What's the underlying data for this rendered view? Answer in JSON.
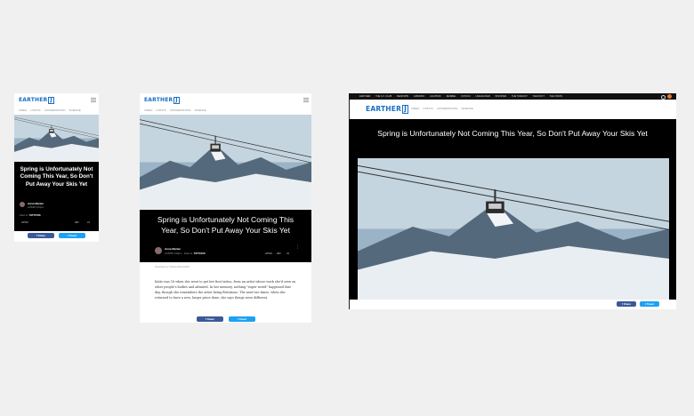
{
  "brand": {
    "logo_text": "EARTHER",
    "logo_box": "J"
  },
  "nav": {
    "items": [
      "VIDEO",
      "LISTICS",
      "CONVERSATION",
      "SCIENCE"
    ]
  },
  "desktop_topbar": {
    "items": [
      "EARTHER",
      "THE A.V. CLUB",
      "DEADSPIN",
      "GIZMODO",
      "JALOPNIK",
      "JEZEBEL",
      "KOTAKU",
      "LIFEHACKER",
      "SPLINTER",
      "THE TAKEOUT",
      "THE ROOT",
      "THE ONION"
    ]
  },
  "article": {
    "title": "Spring is Unfortunately Not Coming This Year, So Don't Put Away Your Skis Yet",
    "author": "Anna Merlan",
    "date_mobile": "1/25/98 3:23pm",
    "date_tablet": "1/25/98 3:23pm",
    "filed_label": "Filed to:",
    "filed_tag": "TATTOOS",
    "filed_suffix": "∙",
    "views": "2251K",
    "comments": "282",
    "stars": "21",
    "illustration_credit": "Illustration by Chelsea Beck/GMG",
    "body_text": "Katie was 16 when she went to get her first tattoo, from an artist whose work she'd seen on other people's bodies and admired. In her memory, nothing \"super weird\" happened that day, though she remembers the artist being flirtatious. The next two times, when she returned to have a new, larger piece done, she says things were different."
  },
  "share": {
    "facebook": "Share",
    "twitter": "Tweet"
  },
  "colors": {
    "brand_blue": "#1a6fc4",
    "facebook": "#3b5998",
    "twitter": "#1da1f2",
    "accent_orange": "#e8772e"
  }
}
